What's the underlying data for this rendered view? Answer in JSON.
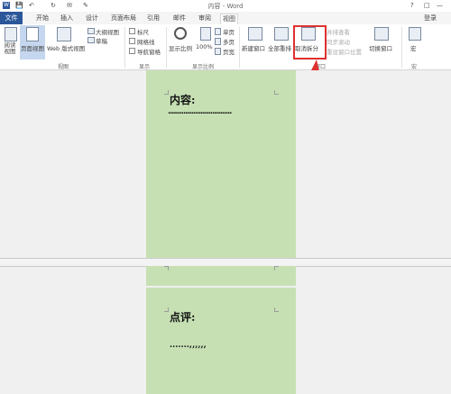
{
  "window": {
    "title": "内容 - Word",
    "login": "登录"
  },
  "tabs": [
    "文件",
    "开始",
    "插入",
    "设计",
    "页面布局",
    "引用",
    "邮件",
    "审阅",
    "视图"
  ],
  "ribbon": {
    "views": {
      "read_mode": "阅读视图",
      "print_layout": "页面视图",
      "web_layout": "Web 版式视图",
      "outline": "大纲视图",
      "draft": "草稿",
      "group": "视图"
    },
    "show": {
      "ruler": "标尺",
      "gridlines": "网格线",
      "nav_pane": "导航窗格",
      "group": "显示"
    },
    "zoom": {
      "zoom": "显示比例",
      "hundred": "100%",
      "one_page": "单页",
      "multi_page": "多页",
      "page_width": "页宽",
      "group": "显示比例"
    },
    "window": {
      "new_window": "新建窗口",
      "arrange_all": "全部重排",
      "remove_split": "取消拆分",
      "side_by_side": "并排查看",
      "sync_scroll": "同步滚动",
      "reset_pos": "重设窗口位置",
      "switch": "切换窗口",
      "group": "窗口"
    },
    "macros": {
      "macros": "宏",
      "group": "宏"
    }
  },
  "document": {
    "top_heading": "内容:",
    "top_dots": ".................................",
    "bottom_heading": "点评:",
    "bottom_dots": ".......,,,,,,"
  },
  "colors": {
    "file_tab": "#2b579a",
    "page_bg": "#c6e0b4",
    "highlight_box": "#e03030",
    "arrow": "#e03030"
  }
}
